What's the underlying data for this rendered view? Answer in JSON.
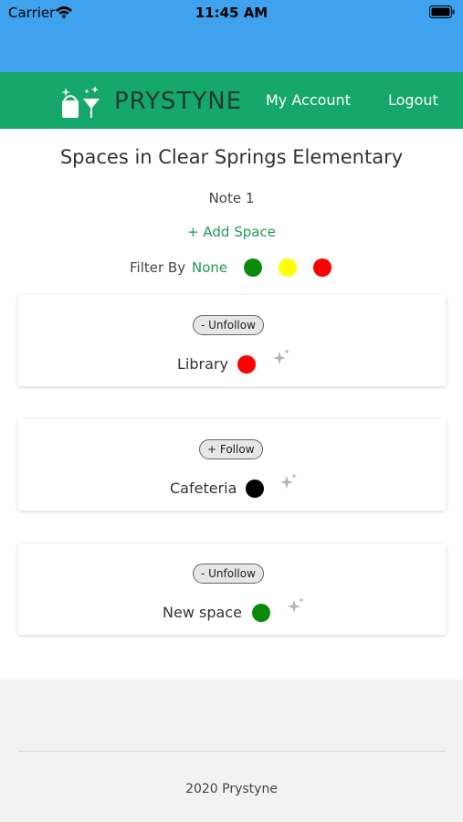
{
  "status_bar": {
    "carrier": "Carrier",
    "time": "11:45 AM"
  },
  "header": {
    "brand": "PRYSTYNE",
    "nav": {
      "account": "My Account",
      "logout": "Logout"
    },
    "colors": {
      "bar": "#16a86a",
      "status": "#3ea2ef"
    }
  },
  "page": {
    "title": "Spaces in Clear Springs Elementary",
    "note": "Note 1",
    "add_space": "+ Add Space",
    "filter": {
      "label": "Filter By",
      "none_label": "None",
      "colors": [
        "#0a8a0a",
        "#ffff00",
        "#ff0000"
      ]
    }
  },
  "spaces": [
    {
      "follow_label": "- Unfollow",
      "name": "Library",
      "status_color": "#ff0000",
      "icon": "sparkle-icon"
    },
    {
      "follow_label": "+ Follow",
      "name": "Cafeteria",
      "status_color": "#000000",
      "icon": "sparkle-icon"
    },
    {
      "follow_label": "- Unfollow",
      "name": "New space",
      "status_color": "#0a8a0a",
      "icon": "sparkle-icon"
    }
  ],
  "footer": {
    "text": "2020 Prystyne"
  }
}
